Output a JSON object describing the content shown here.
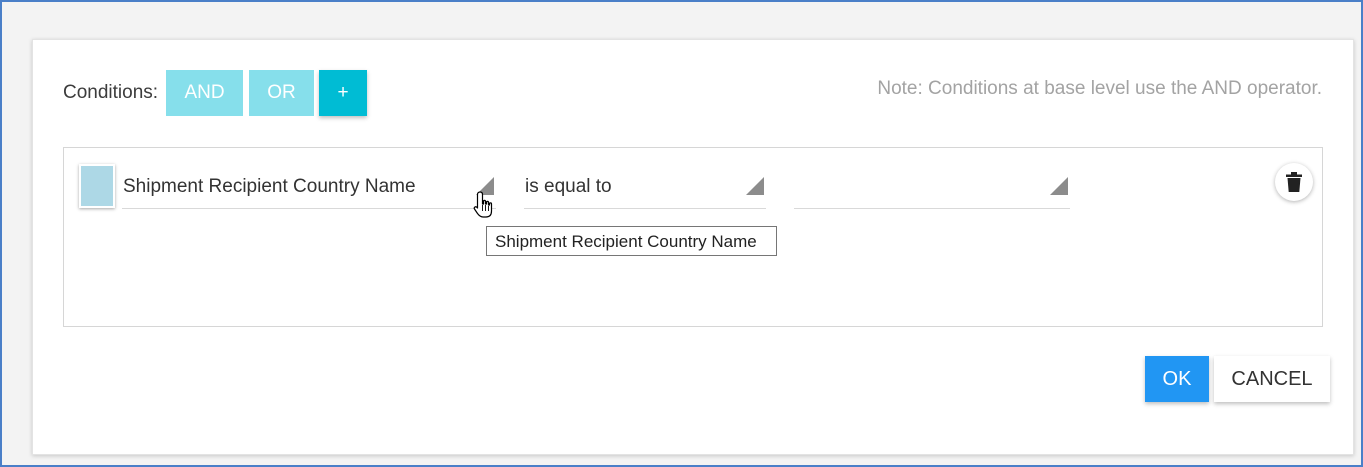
{
  "header": {
    "conditions_label": "Conditions:",
    "and_label": "AND",
    "or_label": "OR",
    "add_label": "+",
    "note": "Note: Conditions at base level use the AND operator."
  },
  "condition": {
    "field_value": "Shipment Recipient Country Name",
    "operator_value": "is equal to",
    "value_value": "",
    "swatch_color": "#add8e6",
    "delete_icon": "trash-icon"
  },
  "tooltip": {
    "text": "Shipment Recipient Country Name"
  },
  "footer": {
    "ok_label": "OK",
    "cancel_label": "CANCEL"
  },
  "colors": {
    "accent": "#00bcd4",
    "accent_light": "#86dfeb",
    "primary": "#2196f3"
  }
}
